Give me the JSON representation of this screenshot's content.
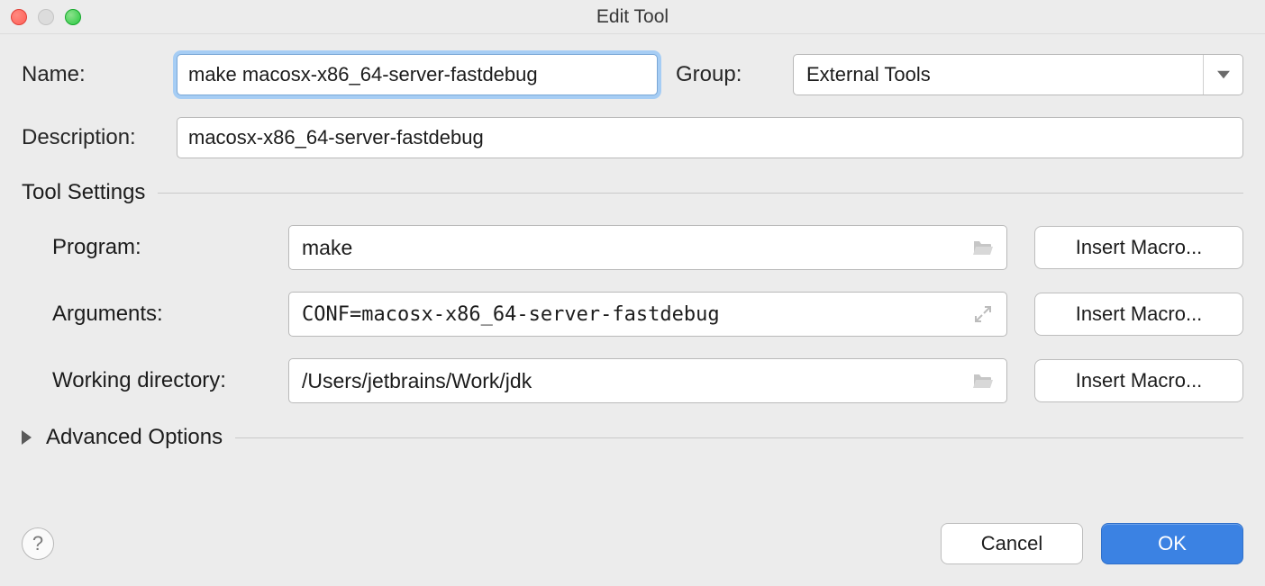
{
  "window": {
    "title": "Edit Tool"
  },
  "form": {
    "name_label": "Name:",
    "name_value": "make macosx-x86_64-server-fastdebug",
    "group_label": "Group:",
    "group_value": "External Tools",
    "description_label": "Description:",
    "description_value": "macosx-x86_64-server-fastdebug"
  },
  "tool_settings": {
    "header": "Tool Settings",
    "program_label": "Program:",
    "program_value": "make",
    "arguments_label": "Arguments:",
    "arguments_value": "CONF=macosx-x86_64-server-fastdebug",
    "workdir_label": "Working directory:",
    "workdir_value": "/Users/jetbrains/Work/jdk",
    "insert_macro_label": "Insert Macro..."
  },
  "advanced": {
    "header": "Advanced Options"
  },
  "footer": {
    "help_label": "?",
    "cancel_label": "Cancel",
    "ok_label": "OK"
  }
}
